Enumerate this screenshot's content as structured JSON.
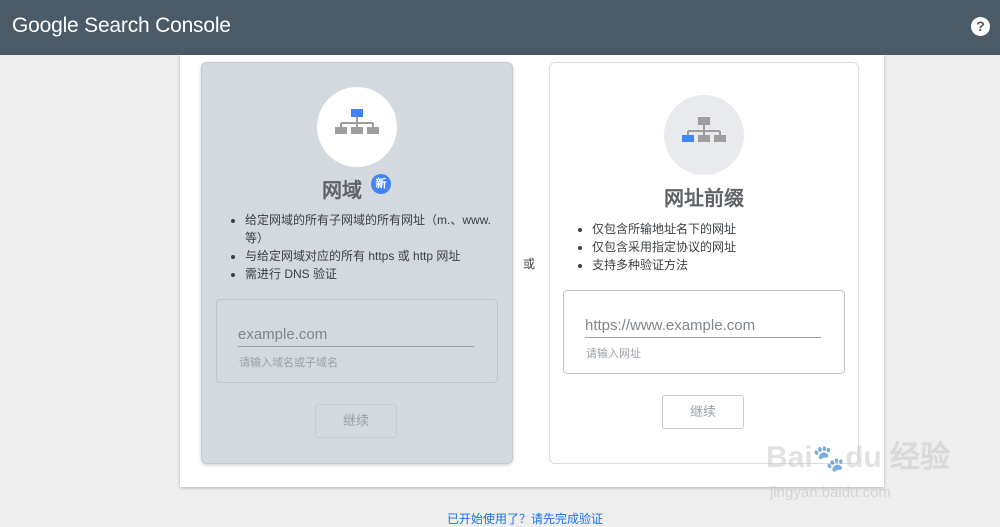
{
  "header": {
    "brand": "Google Search Console",
    "help_icon": "help-circle-icon",
    "help_glyph": "?"
  },
  "colors": {
    "appbar": "#4a5a66",
    "accent_blue": "#4285f4",
    "link": "#1a73e8"
  },
  "domain_card": {
    "icon": "sitemap-icon",
    "title": "网域",
    "badge": "新",
    "bullets": [
      "给定网域的所有子网域的所有网址（m.、www. 等）",
      "与给定网域对应的所有 https 或 http 网址",
      "需进行 DNS 验证"
    ],
    "input_placeholder": "example.com",
    "input_value": "",
    "helper_text": "请输入域名或子域名",
    "button_label": "继续"
  },
  "separator": "或",
  "prefix_card": {
    "icon": "sitemap-icon",
    "title": "网址前缀",
    "bullets": [
      "仅包含所输地址名下的网址",
      "仅包含采用指定协议的网址",
      "支持多种验证方法"
    ],
    "input_placeholder": "https://www.example.com",
    "input_value": "",
    "helper_text": "请输入网址",
    "button_label": "继续"
  },
  "footer_link": "已开始使用了？请先完成验证",
  "watermark": {
    "logo": "Bai du 经验",
    "url": "jingyan.baidu.com"
  }
}
